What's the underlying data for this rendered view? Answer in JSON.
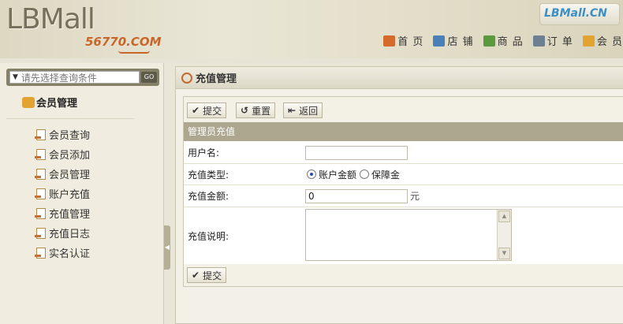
{
  "header": {
    "logo": "LBMall",
    "logo_sub": "56770.COM",
    "brand": "LBMall.CN",
    "nav": [
      {
        "label": "首 页",
        "icon": "home-icon",
        "color": "#d46a2b"
      },
      {
        "label": "店 铺",
        "icon": "store-icon",
        "color": "#4a7fb8"
      },
      {
        "label": "商 品",
        "icon": "goods-icon",
        "color": "#5a9a3c"
      },
      {
        "label": "订 单",
        "icon": "order-icon",
        "color": "#6f7f92"
      },
      {
        "label": "会 员",
        "icon": "member-icon",
        "color": "#e3a331"
      }
    ]
  },
  "sidebar": {
    "search_placeholder": "请先选择查询条件",
    "go_label": "GO",
    "title": "会员管理",
    "items": [
      {
        "label": "会员查询"
      },
      {
        "label": "会员添加"
      },
      {
        "label": "会员管理"
      },
      {
        "label": "账户充值"
      },
      {
        "label": "充值管理"
      },
      {
        "label": "充值日志"
      },
      {
        "label": "实名认证"
      }
    ]
  },
  "main": {
    "title": "充值管理",
    "toolbar": {
      "submit": "提交",
      "reset": "重置",
      "back": "返回"
    },
    "section_title": "管理员充值",
    "form": {
      "username_label": "用户名:",
      "username_value": "",
      "type_label": "充值类型:",
      "type_options": [
        "账户金额",
        "保障金"
      ],
      "amount_label": "充值金额:",
      "amount_value": "0",
      "amount_unit": "元",
      "note_label": "充值说明:"
    },
    "bottom_submit": "提交"
  }
}
